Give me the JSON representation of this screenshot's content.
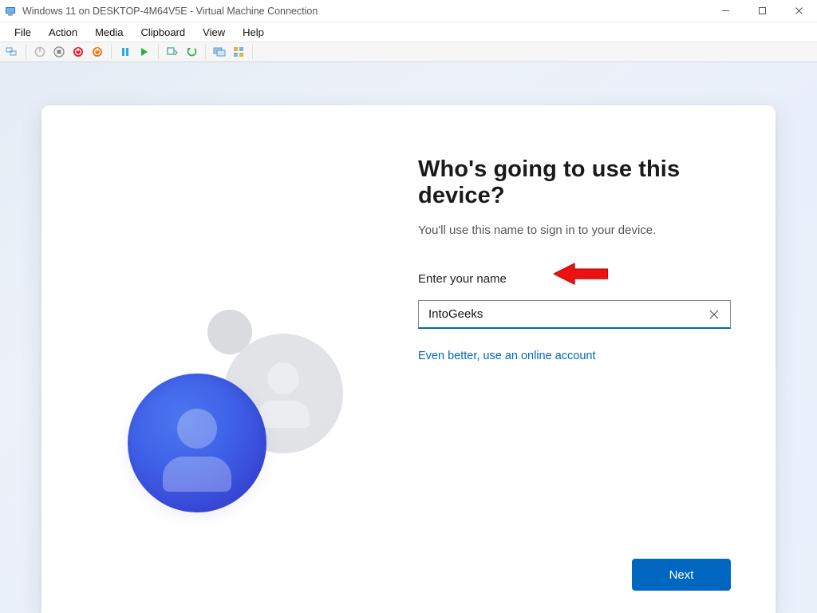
{
  "host": {
    "title": "Windows 11 on DESKTOP-4M64V5E - Virtual Machine Connection",
    "menus": [
      "File",
      "Action",
      "Media",
      "Clipboard",
      "View",
      "Help"
    ]
  },
  "oobe": {
    "title": "Who's going to use this device?",
    "subtitle": "You'll use this name to sign in to your device.",
    "name_label": "Enter your name",
    "name_value": "IntoGeeks",
    "online_link": "Even better, use an online account",
    "next_label": "Next"
  }
}
